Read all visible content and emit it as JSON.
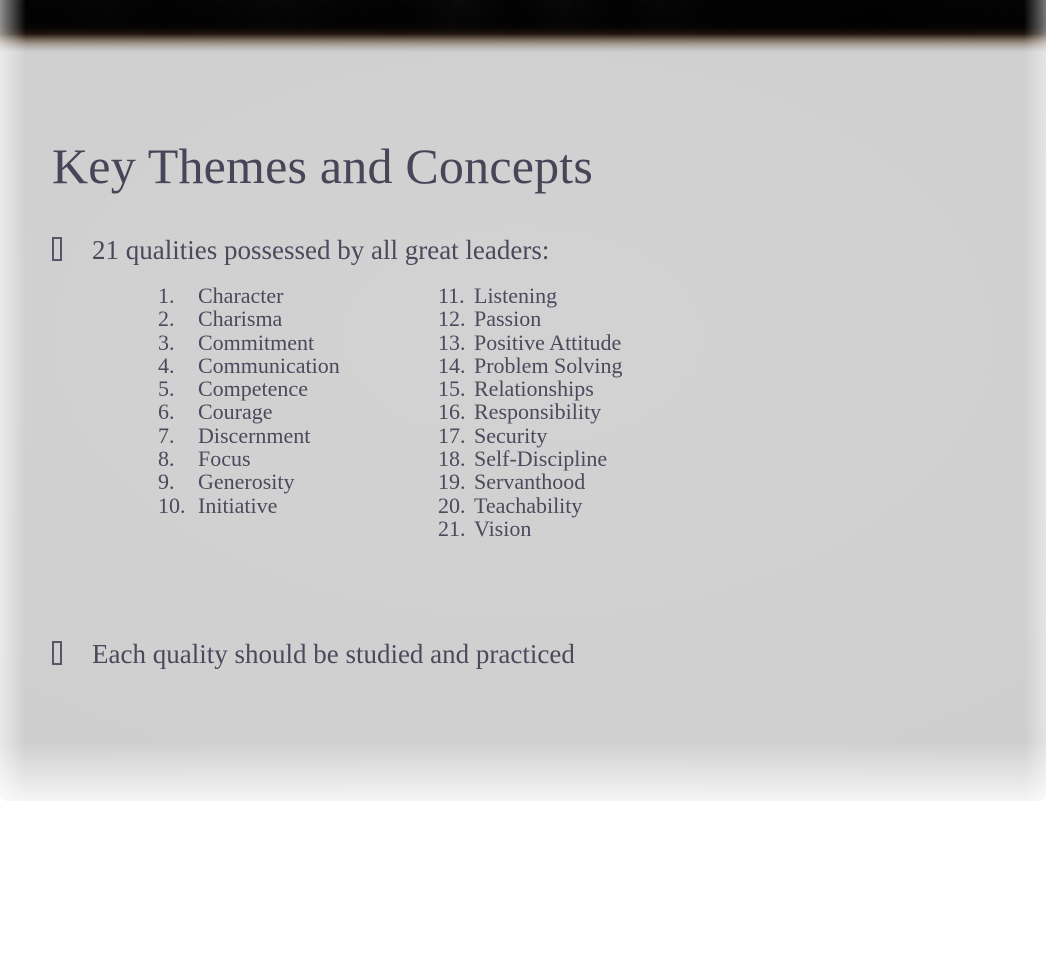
{
  "slide": {
    "title": "Key Themes and Concepts",
    "bullet_glyph": "missing-glyph-box",
    "bullets": [
      {
        "text": "21 qualities possessed by all great leaders:"
      },
      {
        "text": "Each quality should be studied and practiced"
      }
    ],
    "qualities_list": {
      "left_column": [
        {
          "num": "1.",
          "label": "Character"
        },
        {
          "num": "2.",
          "label": "Charisma"
        },
        {
          "num": "3.",
          "label": "Commitment"
        },
        {
          "num": "4.",
          "label": "Communication"
        },
        {
          "num": "5.",
          "label": "Competence"
        },
        {
          "num": "6.",
          "label": "Courage"
        },
        {
          "num": "7.",
          "label": "Discernment"
        },
        {
          "num": "8.",
          "label": "Focus"
        },
        {
          "num": "9.",
          "label": "Generosity"
        },
        {
          "num": "10.",
          "label": "Initiative"
        }
      ],
      "right_column": [
        {
          "num": "11.",
          "label": "Listening"
        },
        {
          "num": "12.",
          "label": "Passion"
        },
        {
          "num": "13.",
          "label": "Positive Attitude"
        },
        {
          "num": "14.",
          "label": "Problem Solving"
        },
        {
          "num": "15.",
          "label": "Relationships"
        },
        {
          "num": "16.",
          "label": "Responsibility"
        },
        {
          "num": "17.",
          "label": "Security"
        },
        {
          "num": "18.",
          "label": "Self-Discipline"
        },
        {
          "num": "19.",
          "label": "Servanthood"
        },
        {
          "num": "20.",
          "label": "Teachability"
        },
        {
          "num": "21.",
          "label": "Vision"
        }
      ]
    },
    "colors": {
      "title_text": "#474659",
      "body_text": "#4a4a5c",
      "slide_background": "#d0d0d0",
      "page_background": "#ffffff",
      "banner_dark": "#121212",
      "banner_warm": "#6e4828"
    }
  }
}
